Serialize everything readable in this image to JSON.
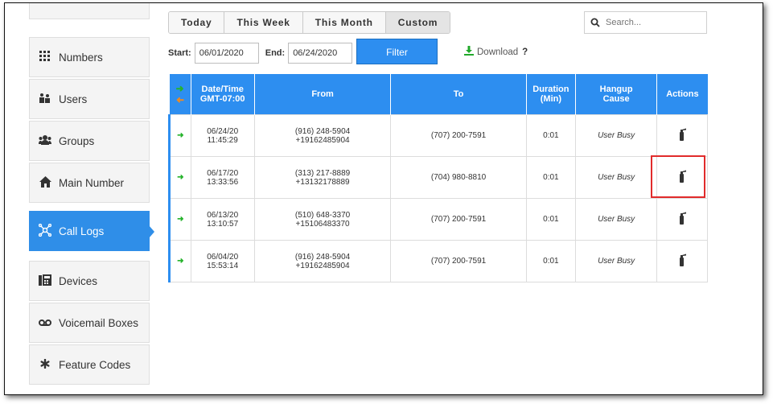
{
  "sidebar": {
    "items": [
      {
        "label": "Numbers",
        "icon": "grid-icon"
      },
      {
        "label": "Users",
        "icon": "users-icon"
      },
      {
        "label": "Groups",
        "icon": "group-icon"
      },
      {
        "label": "Main Number",
        "icon": "home-icon"
      },
      {
        "label": "Call Logs",
        "icon": "network-icon"
      },
      {
        "label": "Devices",
        "icon": "fax-icon"
      },
      {
        "label": "Voicemail Boxes",
        "icon": "voicemail-icon"
      },
      {
        "label": "Feature Codes",
        "icon": "asterisk-icon"
      }
    ],
    "active": "Call Logs"
  },
  "tabs": [
    "Today",
    "This Week",
    "This Month",
    "Custom"
  ],
  "search": {
    "placeholder": "Search..."
  },
  "dates": {
    "start_label": "Start:",
    "start_value": "06/01/2020",
    "end_label": "End:",
    "end_value": "06/24/2020"
  },
  "filter_label": "Filter",
  "download": {
    "label": "Download",
    "help": "?"
  },
  "table": {
    "headers": {
      "datetime_line1": "Date/Time",
      "datetime_line2": "GMT-07:00",
      "from": "From",
      "to": "To",
      "duration_line1": "Duration",
      "duration_line2": "(Min)",
      "hangup_line1": "Hangup",
      "hangup_line2": "Cause",
      "actions": "Actions"
    },
    "rows": [
      {
        "date": "06/24/20",
        "time": "11:45:29",
        "from1": "(916) 248-5904",
        "from2": "+19162485904",
        "to": "(707) 200-7591",
        "duration": "0:01",
        "cause": "User Busy"
      },
      {
        "date": "06/17/20",
        "time": "13:33:56",
        "from1": "(313) 217-8889",
        "from2": "+13132178889",
        "to": "(704) 980-8810",
        "duration": "0:01",
        "cause": "User Busy"
      },
      {
        "date": "06/13/20",
        "time": "13:10:57",
        "from1": "(510) 648-3370",
        "from2": "+15106483370",
        "to": "(707) 200-7591",
        "duration": "0:01",
        "cause": "User Busy"
      },
      {
        "date": "06/04/20",
        "time": "15:53:14",
        "from1": "(916) 248-5904",
        "from2": "+19162485904",
        "to": "(707) 200-7591",
        "duration": "0:01",
        "cause": "User Busy"
      }
    ]
  },
  "colors": {
    "accent": "#2d8ef0",
    "inbound": "#26b32c",
    "outbound": "#f08a1f",
    "highlight": "#e12b2b"
  }
}
